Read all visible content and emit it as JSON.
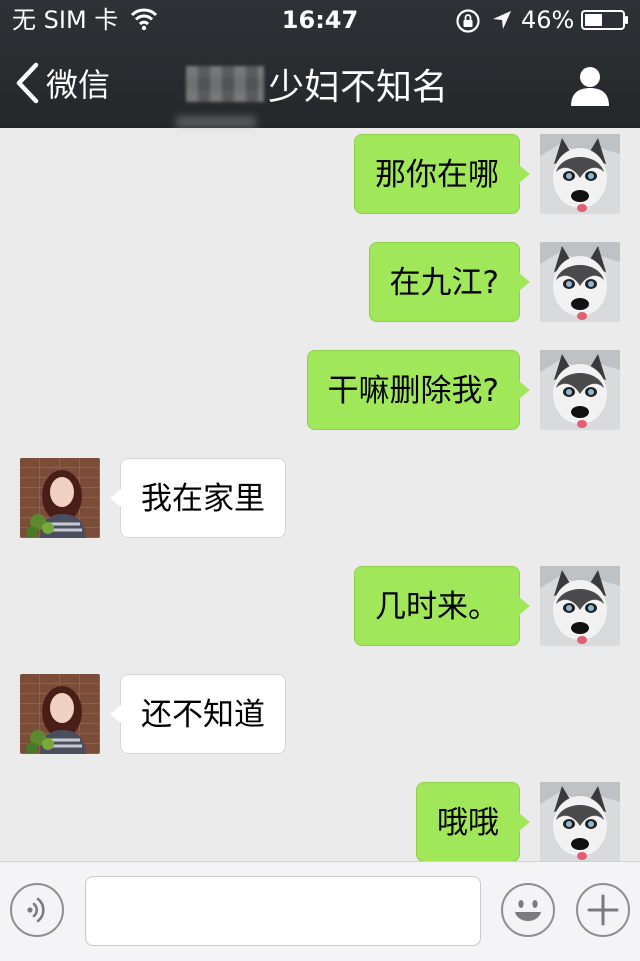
{
  "status_bar": {
    "carrier": "无 SIM 卡",
    "time": "16:47",
    "battery": "46%",
    "icons": [
      "wifi-icon",
      "orientation-lock-icon",
      "location-arrow-icon",
      "battery-icon"
    ]
  },
  "nav": {
    "back_label": "微信",
    "title": "少妇不知名",
    "right_icon": "person-icon"
  },
  "colors": {
    "header_bg": "#2b2e31",
    "chat_bg": "#ebebeb",
    "self_bubble": "#a0e75a",
    "other_bubble": "#ffffff"
  },
  "messages": [
    {
      "sender": "self",
      "text": "那你在哪"
    },
    {
      "sender": "self",
      "text": "在九江?"
    },
    {
      "sender": "self",
      "text": "干嘛删除我?"
    },
    {
      "sender": "other",
      "text": "我在家里"
    },
    {
      "sender": "self",
      "text": "几时来。"
    },
    {
      "sender": "other",
      "text": "还不知道"
    },
    {
      "sender": "self",
      "text": "哦哦"
    }
  ],
  "input_bar": {
    "left_icon": "voice-icon",
    "placeholder": "",
    "right_icons": [
      "emoji-icon",
      "plus-icon"
    ]
  }
}
